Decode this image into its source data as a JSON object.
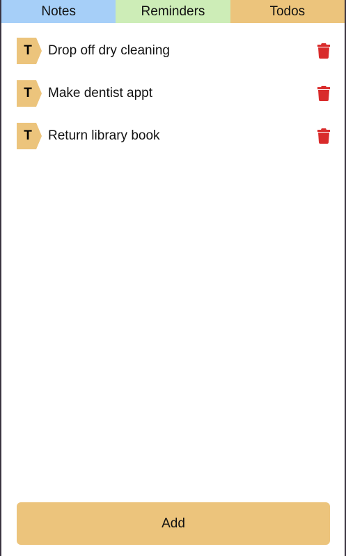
{
  "tabs": [
    {
      "label": "Notes",
      "color": "#a6cff8"
    },
    {
      "label": "Reminders",
      "color": "#cdedb7"
    },
    {
      "label": "Todos",
      "color": "#ecc47c"
    }
  ],
  "active_tab": "Todos",
  "todos": [
    {
      "tag": "T",
      "text": "Drop off dry cleaning",
      "action_icon": "trash-icon"
    },
    {
      "tag": "T",
      "text": "Make dentist appt",
      "action_icon": "trash-icon"
    },
    {
      "tag": "T",
      "text": "Return library book",
      "action_icon": "trash-icon"
    }
  ],
  "add_button": {
    "label": "Add"
  },
  "colors": {
    "tag": "#ecc47c",
    "trash": "#d92b2b",
    "add_button": "#ecc47c",
    "background": "#ffffff"
  }
}
